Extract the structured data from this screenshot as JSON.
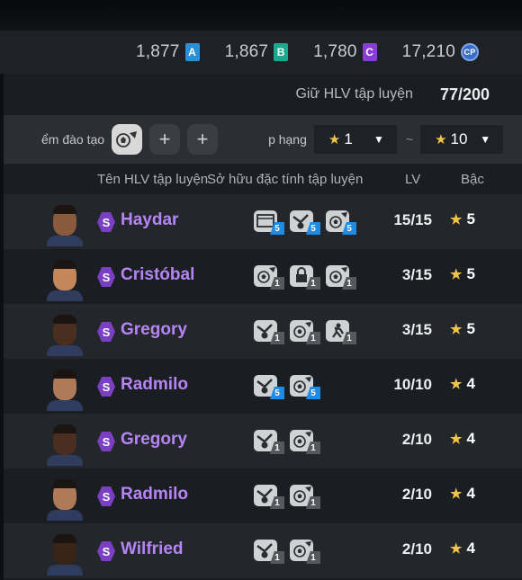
{
  "currencies": [
    {
      "amount": "1,877",
      "badge": "A",
      "color": "#2a8fd6"
    },
    {
      "amount": "1,867",
      "badge": "B",
      "color": "#1aa88f"
    },
    {
      "amount": "1,780",
      "badge": "C",
      "color": "#8a3cd6"
    },
    {
      "amount": "17,210",
      "badge": "CP",
      "color": "#3a6cc9"
    }
  ],
  "hold": {
    "label": "Giữ HLV tập luyện",
    "count": "77/200"
  },
  "filter": {
    "label": "ểm đào tạo",
    "plus": "+",
    "rank_label": "p hạng",
    "rank_min": "1",
    "rank_max": "10",
    "tilde": "~"
  },
  "headers": {
    "name": "Tên HLV tập luyện",
    "traits": "Sở hữu đặc tính tập luyện",
    "lv": "LV",
    "grade": "Bậc"
  },
  "coaches": [
    {
      "grade_badge": "S",
      "name": "Haydar",
      "lv": "15/15",
      "grade": "5",
      "skin": "#8a5a3c",
      "traits": [
        {
          "icon": "board-icon",
          "level": "5",
          "tier": "blue"
        },
        {
          "icon": "whistle-icon",
          "level": "5",
          "tier": "blue"
        },
        {
          "icon": "ball-icon",
          "level": "5",
          "tier": "blue"
        }
      ]
    },
    {
      "grade_badge": "S",
      "name": "Cristóbal",
      "lv": "3/15",
      "grade": "5",
      "skin": "#c4875a",
      "traits": [
        {
          "icon": "ball-icon",
          "level": "1",
          "tier": "grey"
        },
        {
          "icon": "lock-icon",
          "level": "1",
          "tier": "grey"
        },
        {
          "icon": "ball-icon",
          "level": "1",
          "tier": "grey"
        }
      ]
    },
    {
      "grade_badge": "S",
      "name": "Gregory",
      "lv": "3/15",
      "grade": "5",
      "skin": "#4a2e1f",
      "traits": [
        {
          "icon": "whistle-icon",
          "level": "1",
          "tier": "grey"
        },
        {
          "icon": "ball-icon",
          "level": "1",
          "tier": "grey"
        },
        {
          "icon": "runner-icon",
          "level": "1",
          "tier": "grey"
        }
      ]
    },
    {
      "grade_badge": "S",
      "name": "Radmilo",
      "lv": "10/10",
      "grade": "4",
      "skin": "#b07a58",
      "traits": [
        {
          "icon": "whistle-icon",
          "level": "5",
          "tier": "blue"
        },
        {
          "icon": "ball-icon",
          "level": "5",
          "tier": "blue"
        }
      ]
    },
    {
      "grade_badge": "S",
      "name": "Gregory",
      "lv": "2/10",
      "grade": "4",
      "skin": "#4a2e1f",
      "traits": [
        {
          "icon": "whistle-icon",
          "level": "1",
          "tier": "grey"
        },
        {
          "icon": "ball-icon",
          "level": "1",
          "tier": "grey"
        }
      ]
    },
    {
      "grade_badge": "S",
      "name": "Radmilo",
      "lv": "2/10",
      "grade": "4",
      "skin": "#b07a58",
      "traits": [
        {
          "icon": "whistle-icon",
          "level": "1",
          "tier": "grey"
        },
        {
          "icon": "ball-icon",
          "level": "1",
          "tier": "grey"
        }
      ]
    },
    {
      "grade_badge": "S",
      "name": "Wilfried",
      "lv": "2/10",
      "grade": "4",
      "skin": "#3a2418",
      "traits": [
        {
          "icon": "whistle-icon",
          "level": "1",
          "tier": "grey"
        },
        {
          "icon": "ball-icon",
          "level": "1",
          "tier": "grey"
        }
      ]
    }
  ],
  "accent": {
    "star": "#f0c34a",
    "name": "#b685f5",
    "grade_badge": "#7b3fc4"
  }
}
